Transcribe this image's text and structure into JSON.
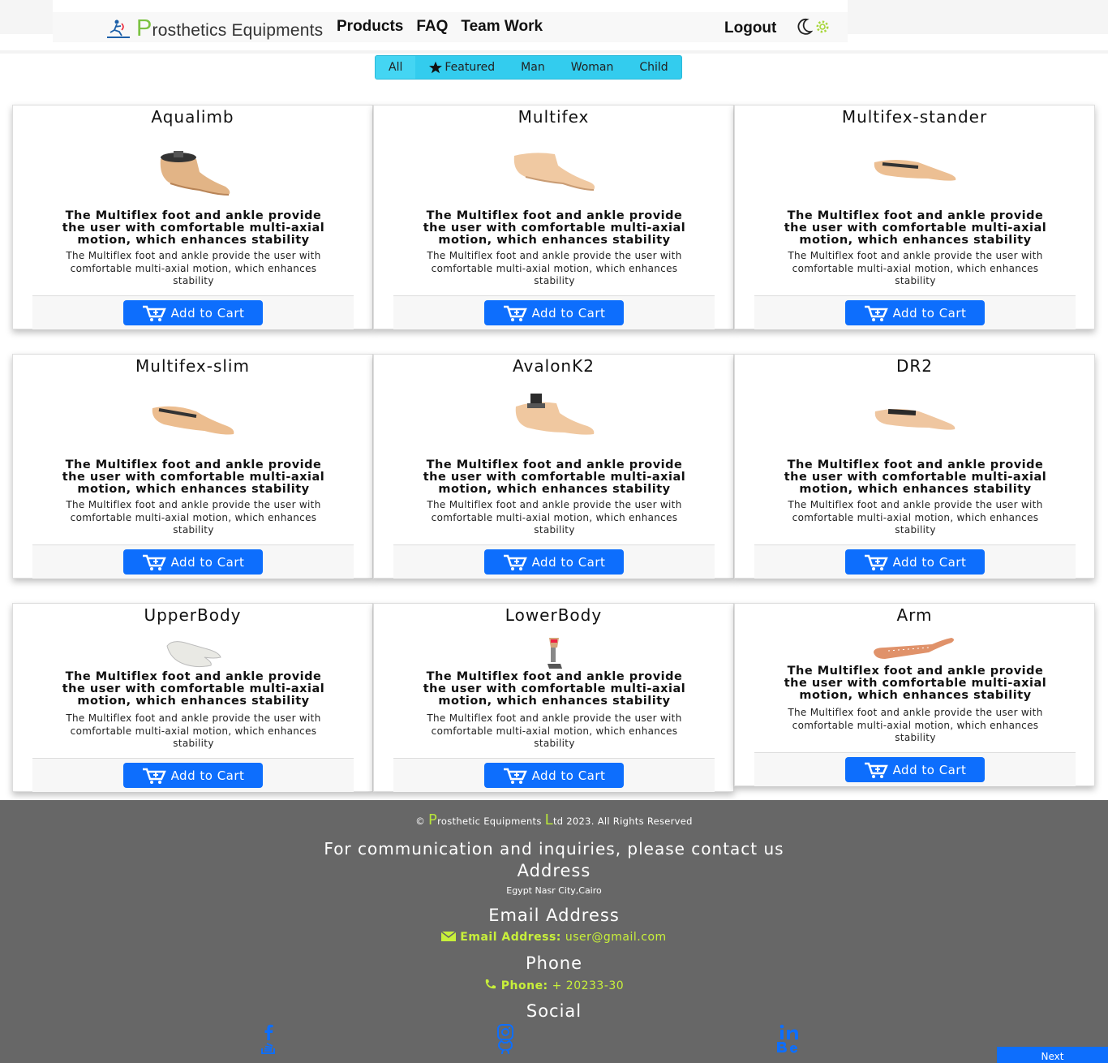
{
  "nav": {
    "brand_initial": "P",
    "brand_rest": "rosthetics Equipments",
    "links": [
      "Products",
      "FAQ",
      "Team Work"
    ],
    "logout": "Logout",
    "icons": [
      "moon-icon",
      "gear-icon"
    ]
  },
  "filters": [
    {
      "label": "All",
      "active": true
    },
    {
      "label": "Featured",
      "icon": "star-icon"
    },
    {
      "label": "Man"
    },
    {
      "label": "Woman"
    },
    {
      "label": "Child"
    }
  ],
  "cards": [
    {
      "title": "Aqualimb",
      "heading": "The Multiflex foot and ankle provide the user with comfortable multi-axial motion, which enhances stability",
      "body": "The Multiflex foot and ankle provide the user with comfortable multi-axial motion, which enhances stability",
      "button": "Add to Cart"
    },
    {
      "title": "Multifex",
      "heading": "The Multiflex foot and ankle provide the user with comfortable multi-axial motion, which enhances stability",
      "body": "The Multiflex foot and ankle provide the user with comfortable multi-axial motion, which enhances stability",
      "button": "Add to Cart"
    },
    {
      "title": "Multifex-stander",
      "heading": "The Multiflex foot and ankle provide the user with comfortable multi-axial motion, which enhances stability",
      "body": "The Multiflex foot and ankle provide the user with comfortable multi-axial motion, which enhances stability",
      "button": "Add to Cart"
    },
    {
      "title": "Multifex-slim",
      "heading": "The Multiflex foot and ankle provide the user with comfortable multi-axial motion, which enhances stability",
      "body": "The Multiflex foot and ankle provide the user with comfortable multi-axial motion, which enhances stability",
      "button": "Add to Cart"
    },
    {
      "title": "AvalonK2",
      "heading": "The Multiflex foot and ankle provide the user with comfortable multi-axial motion, which enhances stability",
      "body": "The Multiflex foot and ankle provide the user with comfortable multi-axial motion, which enhances stability",
      "button": "Add to Cart"
    },
    {
      "title": "DR2",
      "heading": "The Multiflex foot and ankle provide the user with comfortable multi-axial motion, which enhances stability",
      "body": "The Multiflex foot and ankle provide the user with comfortable multi-axial motion, which enhances stability",
      "button": "Add to Cart"
    },
    {
      "title": "UpperBody",
      "heading": "The Multiflex foot and ankle provide the user with comfortable multi-axial motion, which enhances stability",
      "body": "The Multiflex foot and ankle provide the user with comfortable multi-axial motion, which enhances stability",
      "button": "Add to Cart"
    },
    {
      "title": "LowerBody",
      "heading": "The Multiflex foot and ankle provide the user with comfortable multi-axial motion, which enhances stability",
      "body": "The Multiflex foot and ankle provide the user with comfortable multi-axial motion, which enhances stability",
      "button": "Add to Cart"
    },
    {
      "title": "Arm",
      "heading": "The Multiflex foot and ankle provide the user with comfortable multi-axial motion, which enhances stability",
      "body": "The Multiflex foot and ankle provide the user with comfortable multi-axial motion, which enhances stability",
      "button": "Add to Cart"
    }
  ],
  "footer": {
    "copyright_pre": "©",
    "copyright_p": "P",
    "copyright_mid": "rosthetic Equipments",
    "copyright_l": "L",
    "copyright_post": "td 2023. All Rights Reserved",
    "contact_heading": "For communication and inquiries, please contact us",
    "address_heading": "Address",
    "address": "Egypt Nasr City,Cairo",
    "email_heading": "Email Address",
    "email_label": "Email Address:",
    "email": "user@gmail.com",
    "phone_heading": "Phone",
    "phone_label": "Phone:",
    "phone": "+ 20233-30",
    "social_heading": "Social",
    "social_icons": [
      "facebook-icon",
      "stackoverflow-icon",
      "instagram-icon",
      "github-icon",
      "linkedin-icon",
      "behance-icon"
    ],
    "next": "Next"
  },
  "colors": {
    "brand_green": "#7cc242",
    "filter_bg": "#33ccee",
    "button_blue": "#0d6efd",
    "footer_bg": "#676767",
    "footer_accent": "#c8f03a"
  }
}
